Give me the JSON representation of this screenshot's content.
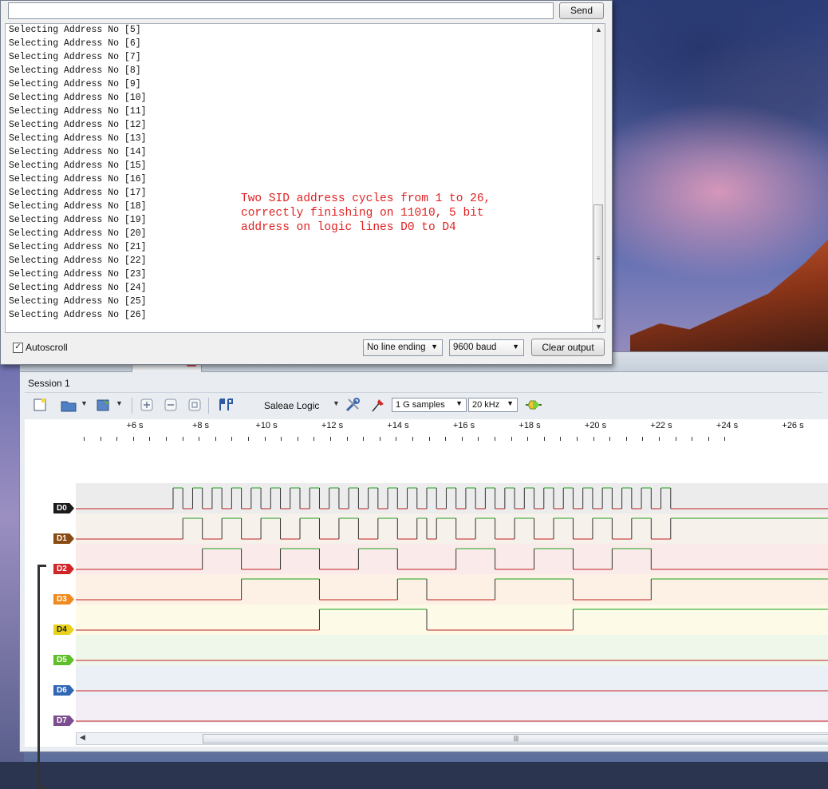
{
  "serial_monitor": {
    "send_input_value": "",
    "send_label": "Send",
    "lines": [
      "Selecting Address No [5]",
      "Selecting Address No [6]",
      "Selecting Address No [7]",
      "Selecting Address No [8]",
      "Selecting Address No [9]",
      "Selecting Address No [10]",
      "Selecting Address No [11]",
      "Selecting Address No [12]",
      "Selecting Address No [13]",
      "Selecting Address No [14]",
      "Selecting Address No [15]",
      "Selecting Address No [16]",
      "Selecting Address No [17]",
      "Selecting Address No [18]",
      "Selecting Address No [19]",
      "Selecting Address No [20]",
      "Selecting Address No [21]",
      "Selecting Address No [22]",
      "Selecting Address No [23]",
      "Selecting Address No [24]",
      "Selecting Address No [25]",
      "Selecting Address No [26]"
    ],
    "annotation": [
      "Two SID address cycles from 1 to 26,",
      "correctly finishing on 11010, 5 bit",
      "address on logic lines D0 to D4"
    ],
    "autoscroll_label": "Autoscroll",
    "autoscroll_checked": true,
    "line_ending": "No line ending",
    "baud": "9600 baud",
    "clear_label": "Clear output"
  },
  "logic": {
    "session_tab": "Session 1",
    "session_label": "Session 1",
    "device": "Saleae Logic",
    "samples": "1 G samples",
    "rate": "20 kHz",
    "time_ticks": [
      "+6 s",
      "+8 s",
      "+10 s",
      "+12 s",
      "+14 s",
      "+16 s",
      "+18 s",
      "+20 s",
      "+22 s",
      "+24 s",
      "+26 s"
    ],
    "channels": [
      {
        "name": "D0",
        "color": "#1b1b1b",
        "lane": "#ececec"
      },
      {
        "name": "D1",
        "color": "#8a4b12",
        "lane": "#f6f1ea"
      },
      {
        "name": "D2",
        "color": "#d0262a",
        "lane": "#fbeaea"
      },
      {
        "name": "D3",
        "color": "#f08a1e",
        "lane": "#fdf1e5"
      },
      {
        "name": "D4",
        "color": "#e8d21c",
        "lane": "#fdfbe8"
      },
      {
        "name": "D5",
        "color": "#5fbf2a",
        "lane": "#eff7ea"
      },
      {
        "name": "D6",
        "color": "#2f66b6",
        "lane": "#ebf0f7"
      },
      {
        "name": "D7",
        "color": "#7c4d8f",
        "lane": "#f3eef5"
      }
    ],
    "colors": {
      "high": "#20a020",
      "low": "#c02020"
    }
  }
}
